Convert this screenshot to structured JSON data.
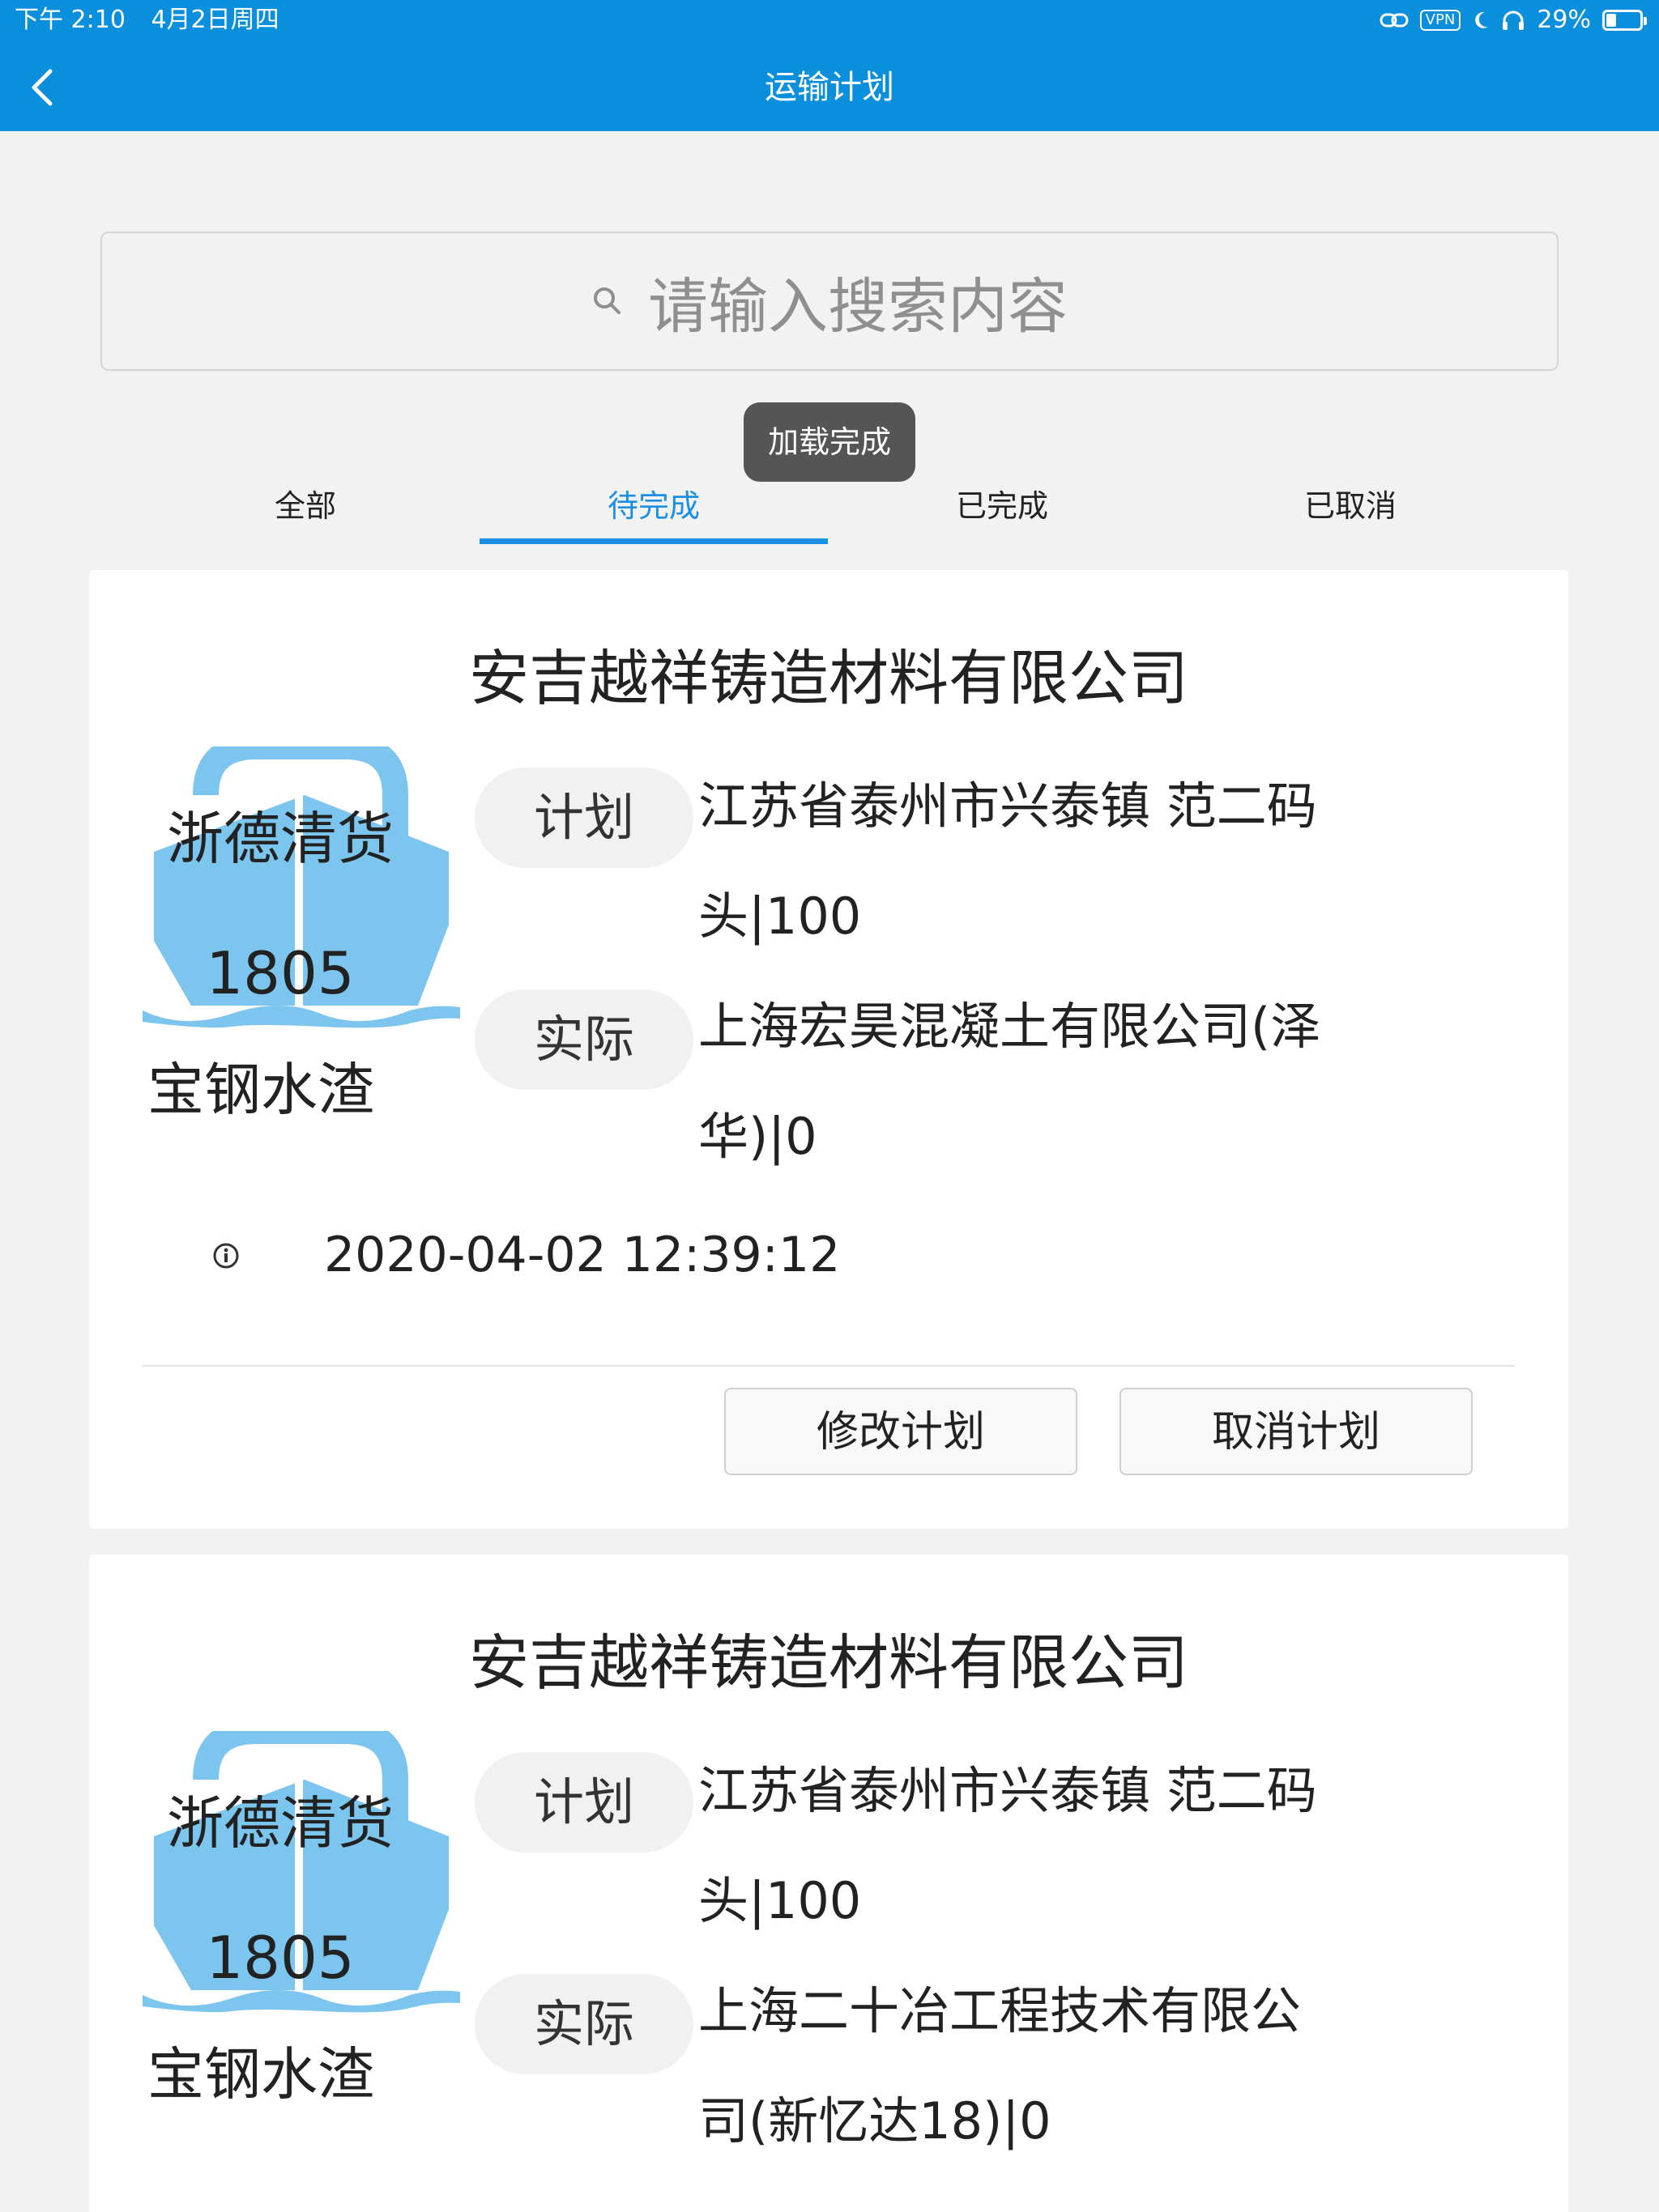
{
  "status_bar": {
    "time": "下午 2:10",
    "date": "4月2日周四",
    "vpn": "VPN",
    "battery": "29%",
    "battery_level": 0.29
  },
  "nav": {
    "title": "运输计划",
    "back_icon": "chevron-left-icon"
  },
  "search": {
    "placeholder": "请输入搜索内容",
    "icon": "search-icon"
  },
  "toast": "加载完成",
  "tabs": [
    {
      "label": "全部",
      "active": false
    },
    {
      "label": "待完成",
      "active": true
    },
    {
      "label": "已完成",
      "active": false
    },
    {
      "label": "已取消",
      "active": false
    }
  ],
  "colors": {
    "brand": "#0a8fdc",
    "tab_active": "#1a8fe3",
    "ship_icon": "#7cc5ee"
  },
  "cards": [
    {
      "company": "安吉越祥铸造材料有限公司",
      "ship_name": "浙德清货",
      "ship_number": "1805",
      "cargo": "宝钢水渣",
      "plan_label": "计划",
      "plan_line1": "江苏省泰州市兴泰镇 范二码",
      "plan_line2": "头|100",
      "actual_label": "实际",
      "actual_line1": "上海宏昊混凝土有限公司(泽",
      "actual_line2": "华)|0",
      "timestamp": "2020-04-02 12:39:12",
      "edit_button": "修改计划",
      "cancel_button": "取消计划"
    },
    {
      "company": "安吉越祥铸造材料有限公司",
      "ship_name": "浙德清货",
      "ship_number": "1805",
      "cargo": "宝钢水渣",
      "plan_label": "计划",
      "plan_line1": "江苏省泰州市兴泰镇 范二码",
      "plan_line2": "头|100",
      "actual_label": "实际",
      "actual_line1": "上海二十冶工程技术有限公",
      "actual_line2": "司(新忆达18)|0"
    }
  ]
}
